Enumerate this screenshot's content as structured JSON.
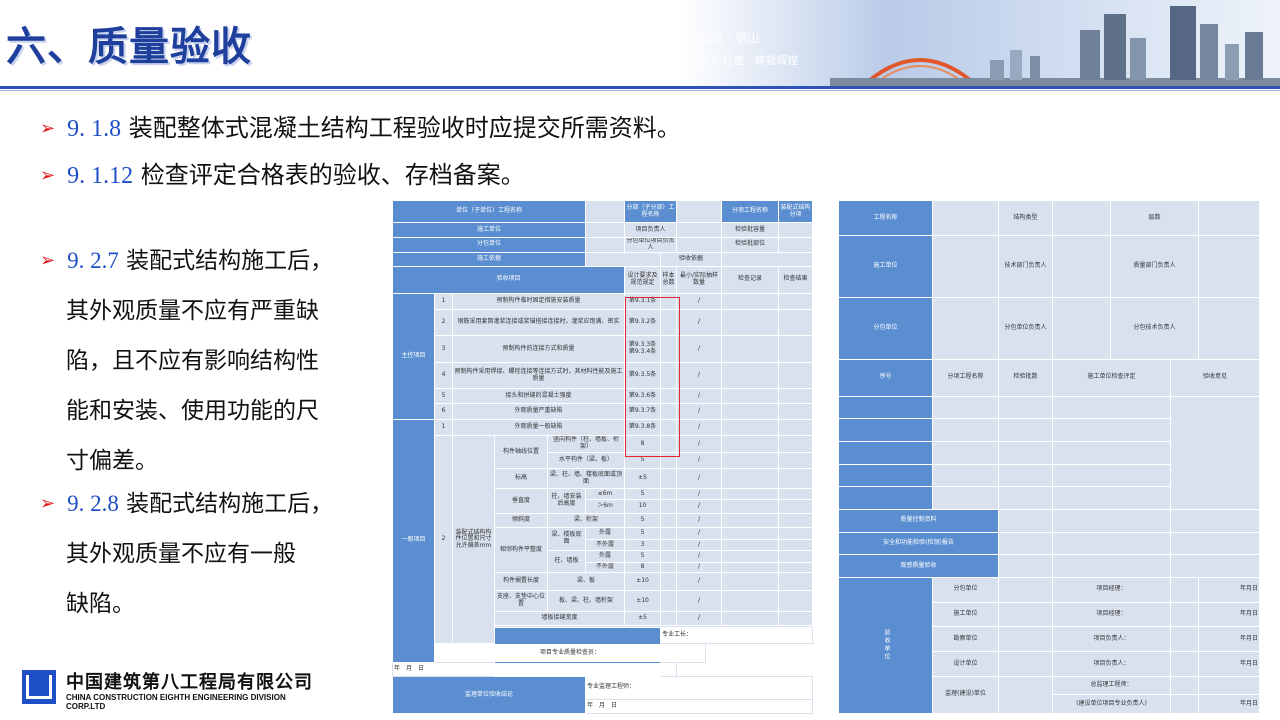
{
  "header": {
    "title": "六、质量验收",
    "skyline_caption_lines": [
      "山水 · 钢山",
      "匠心打造 · 铸就辉煌"
    ]
  },
  "bullets": [
    {
      "code": "9. 1.8",
      "text": " 装配整体式混凝土结构工程验收时应提交所需资料。"
    },
    {
      "code": "9. 1.12",
      "text": " 检查评定合格表的验收、存档备案。"
    }
  ],
  "paragraphs": [
    {
      "code": "9. 2.7",
      "lines": [
        " 装配式结构施工后，",
        "其外观质量不应有严重缺",
        "陷，且不应有影响结构性",
        "能和安装、使用功能的尺",
        "寸偏差。"
      ]
    },
    {
      "code": "9. 2.8",
      "lines": [
        " 装配式结构施工后，",
        "其外观质量不应有一般",
        "缺陷。"
      ]
    }
  ],
  "logo": {
    "name_cn": "中国建筑第八工程局有限公司",
    "name_en": "CHINA CONSTRUCTION EIGHTH ENGINEERING DIVISION CORP.LTD",
    "mark": "CSCEC"
  },
  "left_form": {
    "r1": [
      "单位（子单位）工程名称",
      "分部（子分部）工程名称",
      "分项工程名称",
      "装配式结构分项"
    ],
    "r2": [
      "施工单位",
      "项目负责人",
      "检验批容量"
    ],
    "r3": [
      "分包单位",
      "分包单位项目负责人",
      "检验批部位"
    ],
    "r4": [
      "施工依据",
      "验收依据"
    ],
    "r5": [
      "验收项目",
      "设计要求及规范规定",
      "样本总数",
      "最小/实际抽样数量",
      "检查记录",
      "检查结果"
    ],
    "main_label": "主控项目",
    "main_items": [
      [
        "1",
        "预制构件临时固定措施安装质量",
        "第9.3.1条"
      ],
      [
        "2",
        "钢筋采用套筒灌浆连接或浆锚搭接连接时，灌浆应饱满、密实",
        "第9.3.2条"
      ],
      [
        "3",
        "预制构件的连接方式和质量",
        "第9.3.3条 第9.3.4条"
      ],
      [
        "4",
        "预制构件采用焊接、螺栓连接等连接方式时，其材料性能及施工质量",
        "第9.3.5条"
      ],
      [
        "5",
        "接头和拼缝的混凝土强度",
        "第9.3.6条"
      ],
      [
        "6",
        "外观质量严重缺陷",
        "第9.3.7条"
      ]
    ],
    "general_label": "一般项目",
    "general_1": [
      "1",
      "外观质量一般缺陷",
      "第9.3.8条"
    ],
    "general_2_no": "2",
    "general_2_title": "装配式结构构件位置和尺寸允许偏差mm",
    "axis_label": "构件轴线位置",
    "axis_rows": [
      [
        "竖向构件（柱、墙板、桁架）",
        "8"
      ],
      [
        "水平构件（梁、板）",
        "5"
      ]
    ],
    "elev_label": "标高",
    "elev_row": [
      "梁、柱、墙、楼板底面或顶面",
      "±5"
    ],
    "vert_label": "垂直度",
    "vert_sub": "柱、墙安装后高度",
    "vert_rows": [
      [
        "≤6m",
        "5"
      ],
      [
        "＞6m",
        "10"
      ]
    ],
    "tilt_label": "倾斜度",
    "tilt_row": [
      "梁、桁架",
      "5"
    ],
    "flat_label": "相邻构件平整度",
    "flat_groups": [
      {
        "name": "梁、楼板底面",
        "rows": [
          [
            "外露",
            "5"
          ],
          [
            "不外露",
            "3"
          ]
        ]
      },
      {
        "name": "柱、墙板",
        "rows": [
          [
            "外露",
            "5"
          ],
          [
            "不外露",
            "8"
          ]
        ]
      }
    ],
    "tail_rows": [
      [
        "构件搁置长度",
        "梁、板",
        "±10"
      ],
      [
        "支座、支垫中心位置",
        "板、梁、柱、墙桁架",
        "±10"
      ]
    ],
    "seam_row": [
      "墙板接缝宽度",
      "±5"
    ],
    "slash": "/",
    "constr_label": "施工单位检查结果",
    "constr_lines": [
      "专业工长：",
      "项目专业质量检查员：",
      "年　月　日"
    ],
    "super_label": "监理单位验收结论",
    "super_lines": [
      "专业监理工程师：",
      "年　月　日"
    ]
  },
  "right_form": {
    "r1": [
      "工程名称",
      "结构类型",
      "层数"
    ],
    "r2": [
      "施工单位",
      "技术部门负责人",
      "质量部门负责人"
    ],
    "r3": [
      "分包单位",
      "分包单位负责人",
      "分包技术负责人"
    ],
    "r4": [
      "序号",
      "分项工程名称",
      "检验批数",
      "施工单位检查评定",
      "验收意见"
    ],
    "qc": "质量控制资料",
    "safety": "安全和功能检验(检测)报告",
    "appearance": "观感质量验收",
    "accept_label": "验收单位",
    "accept_rows": [
      [
        "分包单位",
        "项目经理：",
        "年月日"
      ],
      [
        "施工单位",
        "项目经理：",
        "年月日"
      ],
      [
        "勘察单位",
        "项目负责人：",
        "年月日"
      ],
      [
        "设计单位",
        "项目负责人：",
        "年月日"
      ]
    ],
    "owner_unit": "监理(建设)单位",
    "owner_line1": "总监理工程师：",
    "owner_line2": "(建设单位项目专业负责人)",
    "owner_date": "年月日"
  },
  "colors": {
    "title": "#1f3f9c",
    "rule": "#2e53b6",
    "arrow": "#e0151b",
    "code": "#1f4fc6",
    "table_header": "#5a8ed0",
    "table_light": "#d9e1ef",
    "highlight": "#e3262b"
  }
}
